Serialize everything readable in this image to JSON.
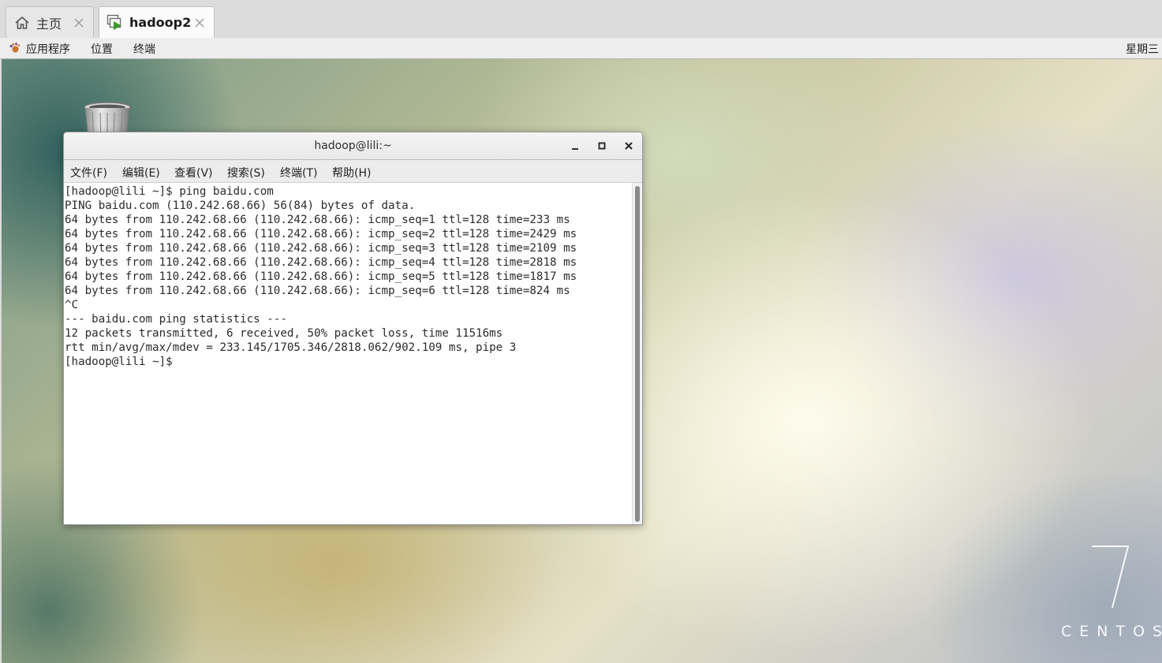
{
  "vm_tabs": [
    {
      "label": "主页",
      "icon": "home-icon",
      "active": false
    },
    {
      "label": "hadoop2",
      "icon": "vm-play-icon",
      "active": true
    }
  ],
  "topbar": {
    "applications": "应用程序",
    "places": "位置",
    "terminal": "终端",
    "clock": "星期三",
    "apps_icon": "gnome-foot-icon"
  },
  "desktop": {
    "trash_icon": "trash-icon",
    "brand_number": "7",
    "brand_name": "CENTOS"
  },
  "terminal": {
    "title": "hadoop@lili:~",
    "buttons": [
      "minimize-icon",
      "maximize-icon",
      "close-icon"
    ],
    "menu": [
      "文件(F)",
      "编辑(E)",
      "查看(V)",
      "搜索(S)",
      "终端(T)",
      "帮助(H)"
    ],
    "lines": [
      "[hadoop@lili ~]$ ping baidu.com",
      "PING baidu.com (110.242.68.66) 56(84) bytes of data.",
      "64 bytes from 110.242.68.66 (110.242.68.66): icmp_seq=1 ttl=128 time=233 ms",
      "64 bytes from 110.242.68.66 (110.242.68.66): icmp_seq=2 ttl=128 time=2429 ms",
      "64 bytes from 110.242.68.66 (110.242.68.66): icmp_seq=3 ttl=128 time=2109 ms",
      "64 bytes from 110.242.68.66 (110.242.68.66): icmp_seq=4 ttl=128 time=2818 ms",
      "64 bytes from 110.242.68.66 (110.242.68.66): icmp_seq=5 ttl=128 time=1817 ms",
      "64 bytes from 110.242.68.66 (110.242.68.66): icmp_seq=6 ttl=128 time=824 ms",
      "^C",
      "--- baidu.com ping statistics ---",
      "12 packets transmitted, 6 received, 50% packet loss, time 11516ms",
      "rtt min/avg/max/mdev = 233.145/1705.346/2818.062/902.109 ms, pipe 3",
      "[hadoop@lili ~]$ "
    ]
  }
}
